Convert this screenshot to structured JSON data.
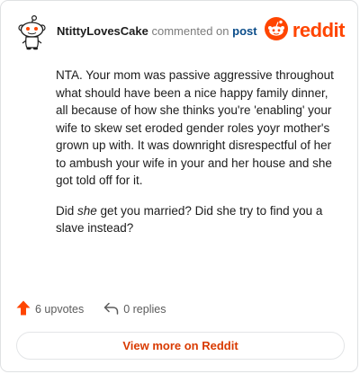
{
  "comment": {
    "author": "NtittyLovesCake",
    "action_text": "commented on",
    "post_link_label": "post",
    "paragraph1": "NTA. Your mom was passive aggressive throughout what should have been a nice happy family dinner, all because of how she thinks you're 'enabling' your wife to skew set eroded gender roles yoyr mother's grown up with. It was downright disrespectful of her to ambush your wife in your and her house and she got told off for it.",
    "paragraph2_before": "Did ",
    "paragraph2_em": "she",
    "paragraph2_after": " get you married? Did she try to find you a slave instead?"
  },
  "brand": {
    "wordmark": "reddit",
    "icon": "reddit-logo-icon",
    "color": "#ff4500"
  },
  "footer": {
    "upvotes_label": "6 upvotes",
    "upvote_icon": "upvote-arrow-icon",
    "upvote_color": "#ff4500",
    "replies_label": "0 replies",
    "reply_icon": "reply-arrow-icon"
  },
  "actions": {
    "view_more_label": "View more on Reddit",
    "view_more_color": "#d93a00"
  },
  "avatar": {
    "icon": "snoo-avatar-icon"
  }
}
